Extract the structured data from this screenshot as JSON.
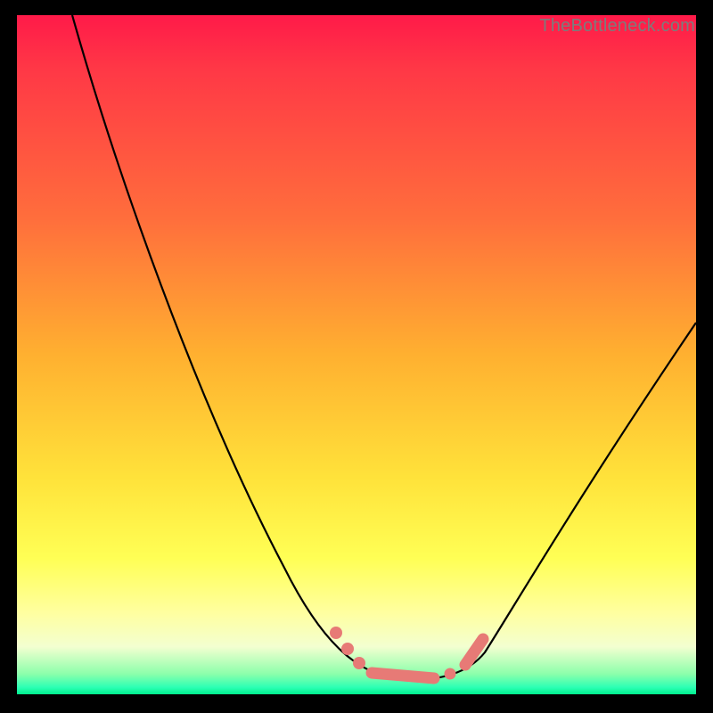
{
  "watermark": "TheBottleneck.com",
  "colors": {
    "gradient_top": "#ff1a49",
    "gradient_mid1": "#ff6e3c",
    "gradient_mid2": "#ffe23a",
    "gradient_mid3": "#ffffa0",
    "gradient_bottom": "#00f08e",
    "curve": "#000000",
    "marker": "#e77a76",
    "frame": "#000000"
  },
  "chart_data": {
    "type": "line",
    "title": "",
    "xlabel": "",
    "ylabel": "",
    "xlim": [
      0,
      100
    ],
    "ylim": [
      0,
      100
    ],
    "series": [
      {
        "name": "bottleneck-curve",
        "x": [
          8,
          10,
          14,
          18,
          22,
          26,
          30,
          34,
          38,
          42,
          45,
          48,
          50,
          52,
          54,
          57,
          60,
          62,
          65,
          70,
          76,
          82,
          88,
          94,
          100
        ],
        "values": [
          100,
          93,
          80,
          68,
          57,
          47,
          38,
          30,
          23,
          16,
          11,
          7,
          5,
          3,
          2.2,
          2,
          2,
          2.5,
          4,
          8,
          16,
          26,
          36,
          46,
          55
        ]
      }
    ],
    "markers": {
      "name": "highlight-region",
      "x": [
        48,
        49,
        50,
        52,
        54,
        56,
        58,
        60,
        62,
        64,
        65,
        66
      ],
      "values": [
        7,
        6,
        5,
        3.2,
        2.4,
        2.1,
        2,
        2,
        2.4,
        3.4,
        4.3,
        5.4
      ]
    },
    "grid": false,
    "legend": false
  }
}
